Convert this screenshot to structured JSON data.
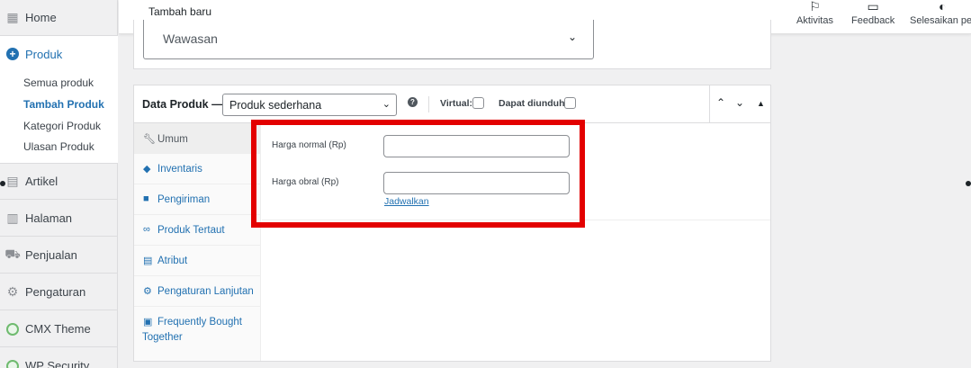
{
  "sidebar": {
    "items": [
      {
        "label": "Home",
        "icon": "dashboard-icon"
      },
      {
        "label": "Produk",
        "icon": "plus-circle-icon"
      },
      {
        "label": "Artikel",
        "icon": "posts-icon"
      },
      {
        "label": "Halaman",
        "icon": "pages-icon"
      },
      {
        "label": "Penjualan",
        "icon": "cart-icon"
      },
      {
        "label": "Pengaturan",
        "icon": "gear-icon"
      },
      {
        "label": "CMX Theme",
        "icon": "theme-icon"
      },
      {
        "label": "WP Security",
        "icon": "security-icon"
      }
    ],
    "submenu": [
      "Semua produk",
      "Tambah Produk",
      "Kategori Produk",
      "Ulasan Produk"
    ]
  },
  "topbar": {
    "title": "Tambah baru",
    "buttons": [
      {
        "label": "Aktivitas",
        "icon": "flag-icon"
      },
      {
        "label": "Feedback",
        "icon": "feedback-icon"
      },
      {
        "label": "Selesaikan per",
        "icon": "half-circle-icon"
      }
    ]
  },
  "top_box": {
    "select_value": "Wawasan"
  },
  "data_produk": {
    "title": "Data Produk —",
    "type_select": "Produk sederhana",
    "virtual_label": "Virtual:",
    "download_label": "Dapat diunduh:",
    "tabs": [
      {
        "label": "Umum",
        "icon": "wrench-icon"
      },
      {
        "label": "Inventaris",
        "icon": "tag-icon"
      },
      {
        "label": "Pengiriman",
        "icon": "truck-icon"
      },
      {
        "label": "Produk Tertaut",
        "icon": "link-icon"
      },
      {
        "label": "Atribut",
        "icon": "list-icon"
      },
      {
        "label": "Pengaturan Lanjutan",
        "icon": "gear-icon"
      },
      {
        "label": "Frequently Bought",
        "label2": "Together",
        "icon": "bag-icon"
      }
    ],
    "fields": {
      "regular_price_label": "Harga normal (Rp)",
      "sale_price_label": "Harga obral (Rp)",
      "regular_price_value": "",
      "sale_price_value": "",
      "schedule_link": "Jadwalkan"
    }
  },
  "colors": {
    "accent": "#2271b1",
    "highlight": "#e30000"
  }
}
